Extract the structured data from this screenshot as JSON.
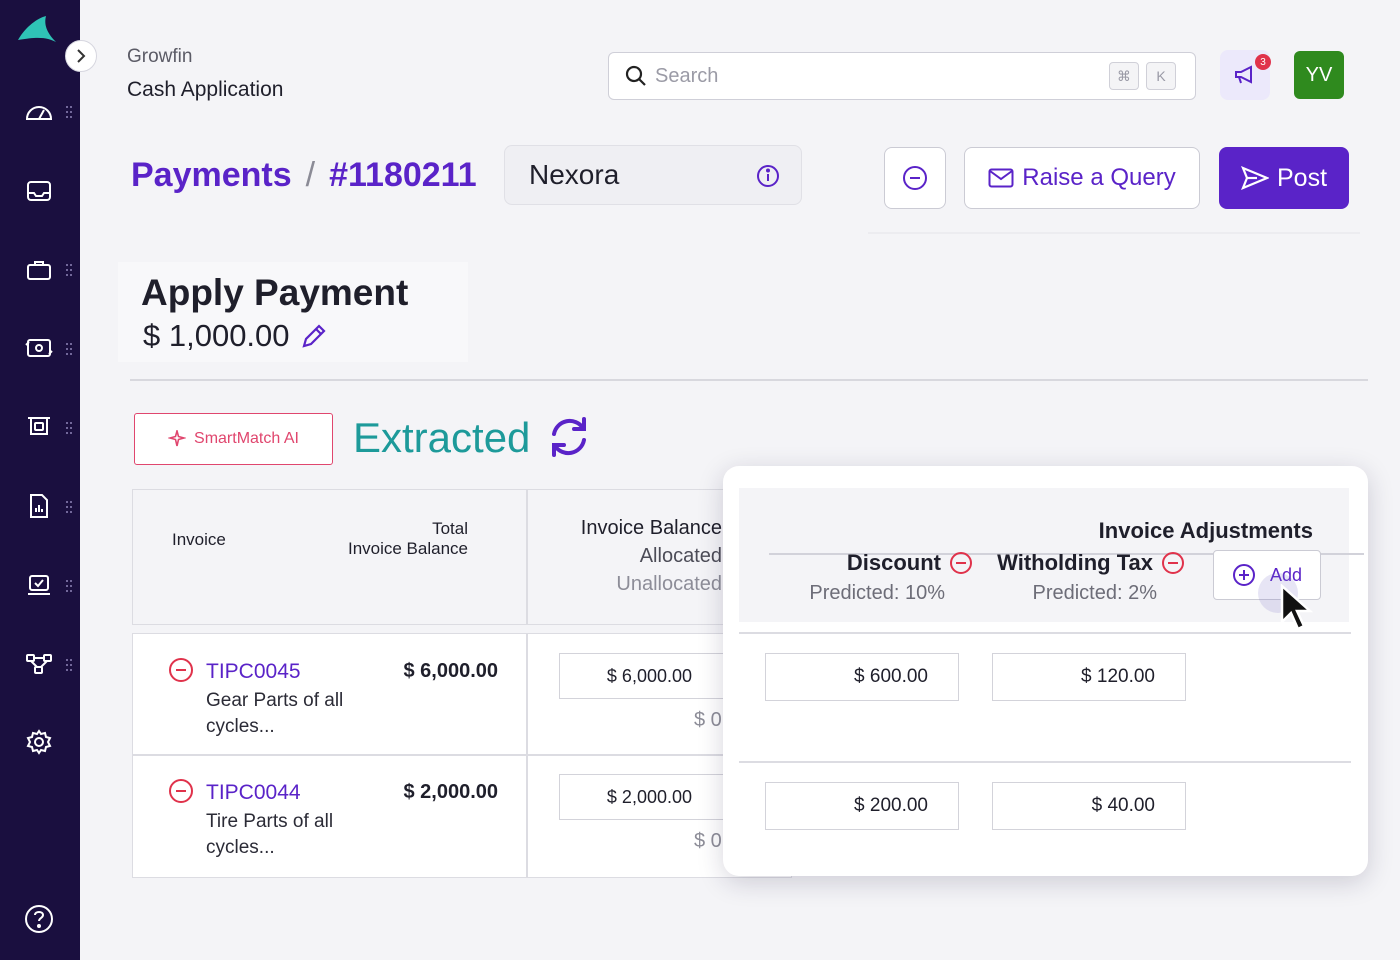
{
  "app": {
    "org": "Growfin",
    "name": "Cash Application"
  },
  "search": {
    "placeholder": "Search",
    "shortcut_mod": "⌘",
    "shortcut_key": "K"
  },
  "notifications": {
    "count": "3"
  },
  "user": {
    "initials": "YV"
  },
  "breadcrumb": {
    "section": "Payments",
    "separator": "/",
    "id": "#1180211"
  },
  "customer": {
    "name": "Nexora"
  },
  "actions": {
    "raise_query": "Raise a Query",
    "post": "Post"
  },
  "apply": {
    "title": "Apply Payment",
    "amount": "$ 1,000.00"
  },
  "smartmatch": {
    "label": "SmartMatch AI",
    "status": "Extracted"
  },
  "table": {
    "headers": {
      "invoice": "Invoice",
      "total_line1": "Total",
      "total_line2": "Invoice Balance",
      "balance_line1": "Invoice Balance",
      "balance_line2": "Allocated",
      "balance_line3": "Unallocated"
    },
    "rows": [
      {
        "id": "TIPC0045",
        "desc": "Gear Parts of all cycles...",
        "total": "$ 6,000.00",
        "allocated": "$ 6,000.00",
        "unallocated": "$ 0"
      },
      {
        "id": "TIPC0044",
        "desc": "Tire Parts of all cycles...",
        "total": "$ 2,000.00",
        "allocated": "$ 2,000.00",
        "unallocated": "$ 0"
      }
    ]
  },
  "adjustments": {
    "title": "Invoice Adjustments",
    "discount_label": "Discount",
    "discount_pred": "Predicted: 10%",
    "tax_label": "Witholding Tax",
    "tax_pred": "Predicted: 2%",
    "add_label": "Add",
    "rows": [
      {
        "discount": "$ 600.00",
        "tax": "$ 120.00"
      },
      {
        "discount": "$ 200.00",
        "tax": "$ 40.00"
      }
    ]
  },
  "colors": {
    "brand": "#5a23c8",
    "sidebar": "#1a0f3f",
    "accent_teal": "#1d9a9a",
    "danger": "#e0324b",
    "avatar": "#2f8a1e"
  }
}
